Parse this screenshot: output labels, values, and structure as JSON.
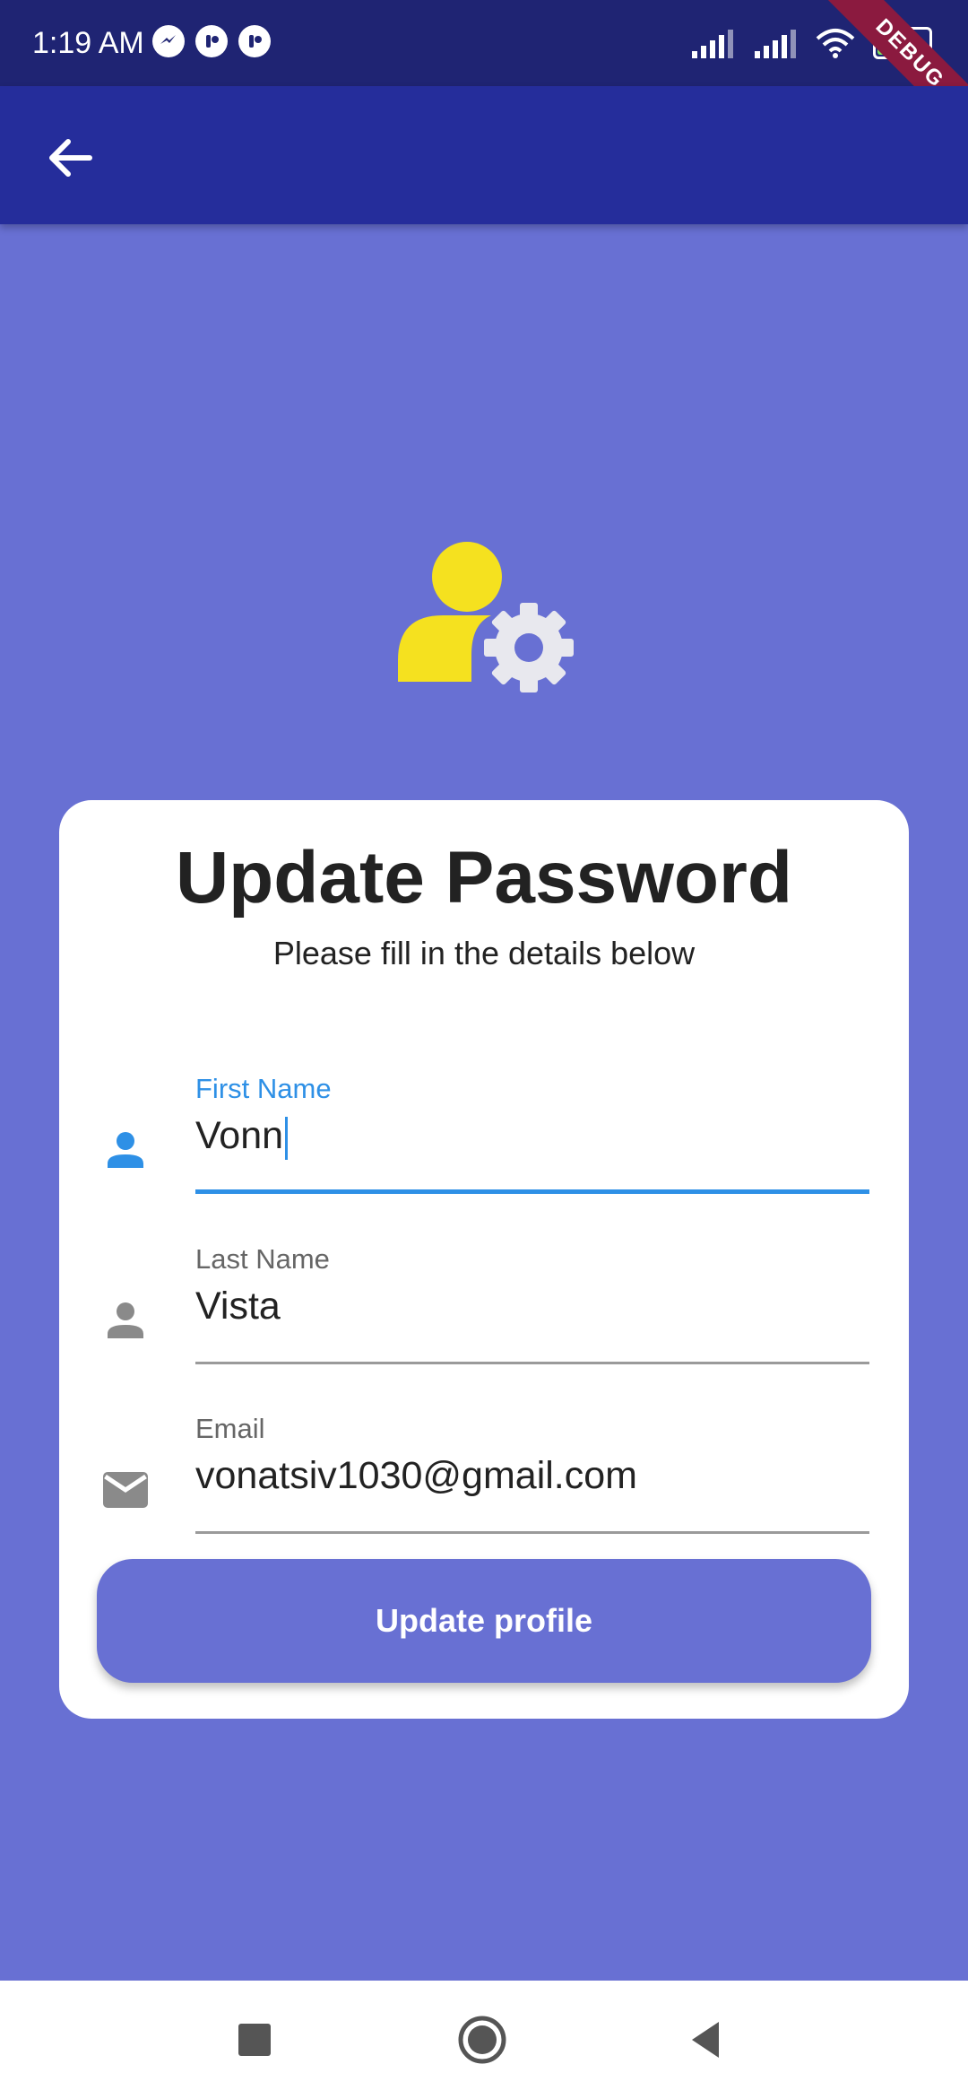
{
  "status_bar": {
    "time": "1:19 AM",
    "battery": "44",
    "debug_banner": "DEBUG"
  },
  "app_bar": {
    "back_icon": "arrow-back-icon"
  },
  "hero": {
    "icon": "user-settings-icon",
    "colors": {
      "person": "#f5e11f",
      "gear": "#e8e8ee"
    }
  },
  "card": {
    "title": "Update Password",
    "subtitle": "Please fill in the details below",
    "fields": [
      {
        "label": "First Name",
        "value": "Vonn",
        "icon": "person-icon",
        "focused": true
      },
      {
        "label": "Last Name",
        "value": "Vista",
        "icon": "person-icon",
        "focused": false
      },
      {
        "label": "Email",
        "value": "vonatsiv1030@gmail.com",
        "icon": "email-icon",
        "focused": false
      }
    ],
    "button_label": "Update profile"
  },
  "colors": {
    "background": "#6870d3",
    "app_bar": "#252d9b",
    "status_bar": "#1f2473",
    "accent": "#2e90e6"
  }
}
